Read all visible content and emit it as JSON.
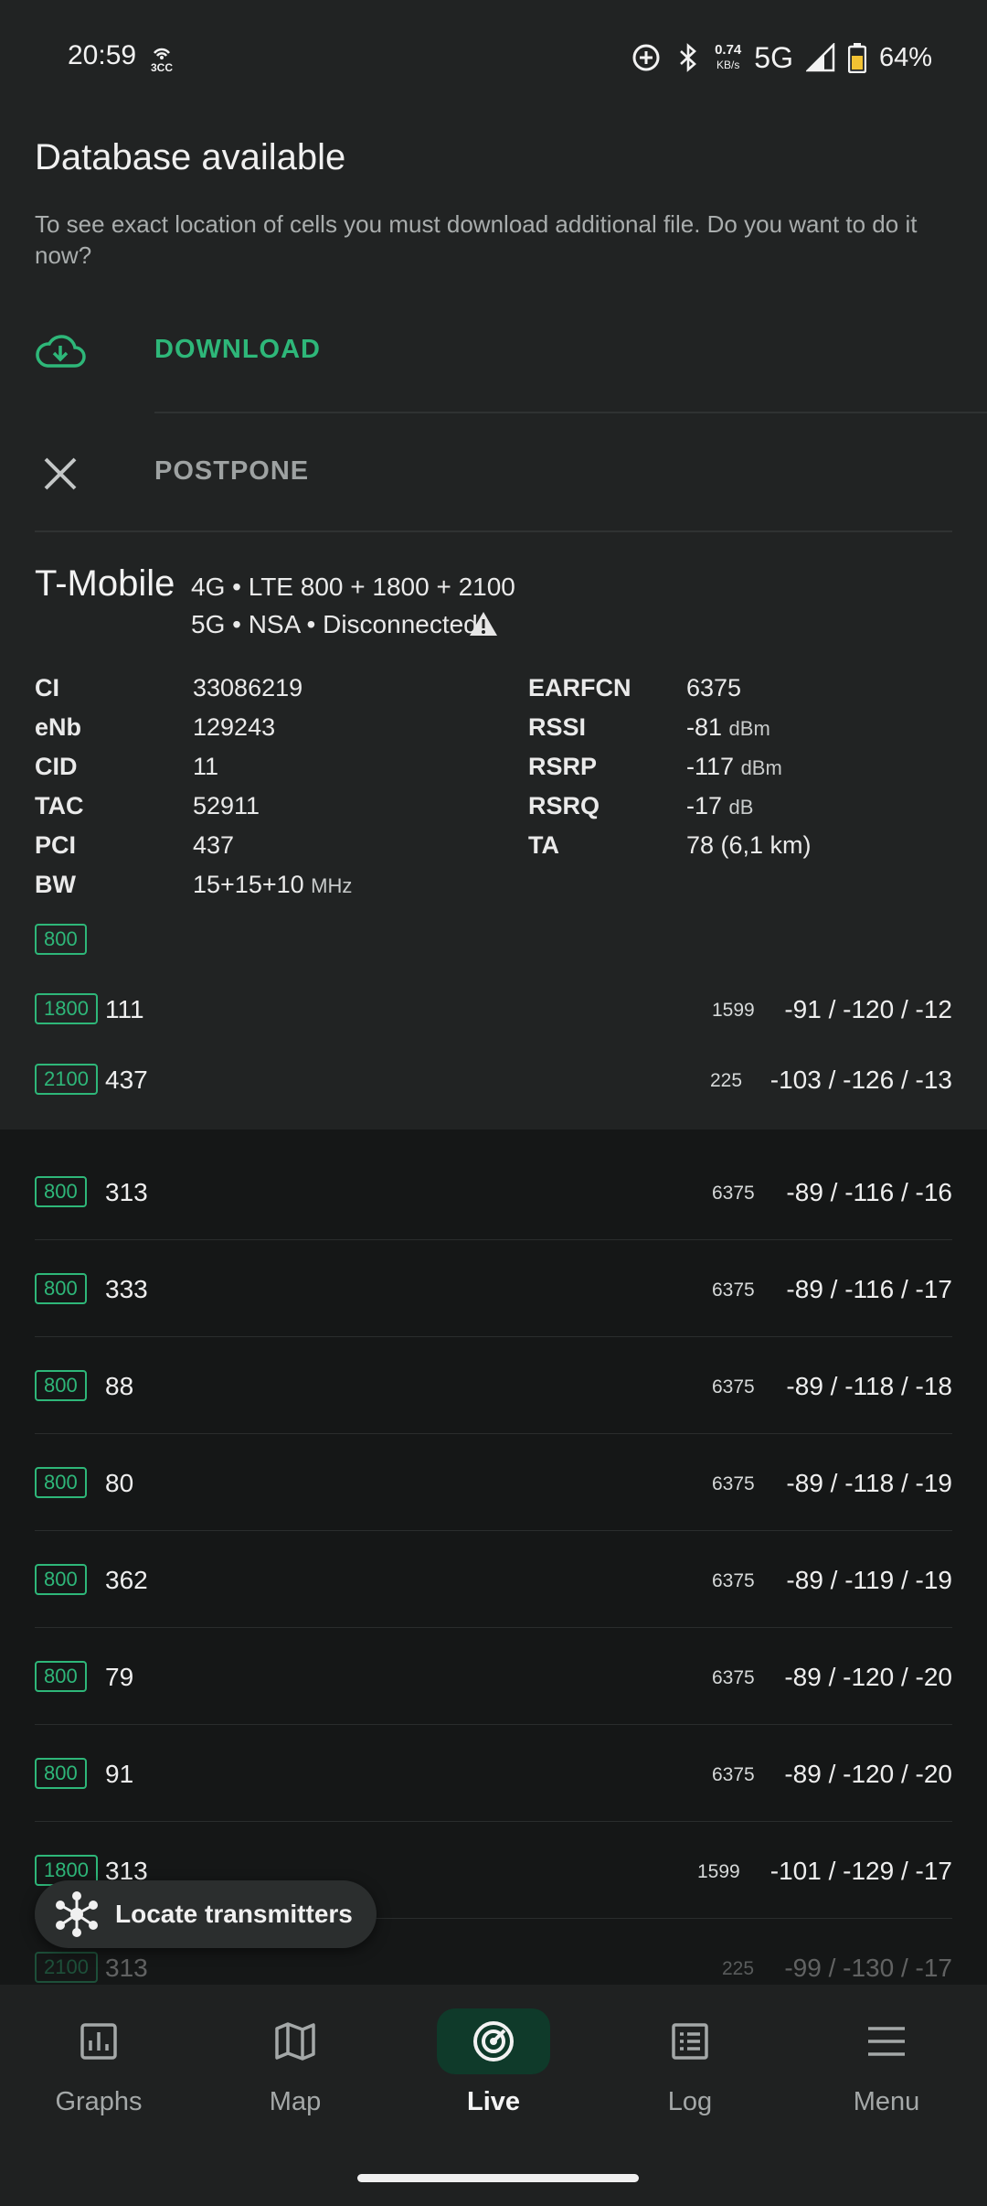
{
  "status_bar": {
    "time": "20:59",
    "carrier_icon_text": "3CC",
    "speed_value": "0.74",
    "speed_unit": "KB/s",
    "network": "5G",
    "battery": "64%"
  },
  "prompt": {
    "title": "Database available",
    "message": "To see exact location of cells you must download additional file. Do you want to do it now?",
    "download_label": "DOWNLOAD",
    "postpone_label": "POSTPONE"
  },
  "operator": {
    "name": "T-Mobile",
    "line1": "4G • LTE 800 + 1800 + 2100",
    "line2": "5G • NSA • Disconnected"
  },
  "cell_info": {
    "left": [
      {
        "key": "CI",
        "value": "33086219",
        "unit": ""
      },
      {
        "key": "eNb",
        "value": "129243",
        "unit": ""
      },
      {
        "key": "CID",
        "value": "11",
        "unit": ""
      },
      {
        "key": "TAC",
        "value": "52911",
        "unit": ""
      },
      {
        "key": "PCI",
        "value": "437",
        "unit": ""
      },
      {
        "key": "BW",
        "value": "15+15+10",
        "unit": "MHz"
      }
    ],
    "right": [
      {
        "key": "EARFCN",
        "value": "6375",
        "unit": ""
      },
      {
        "key": "RSSI",
        "value": "-81",
        "unit": "dBm"
      },
      {
        "key": "RSRP",
        "value": "-117",
        "unit": "dBm"
      },
      {
        "key": "RSRQ",
        "value": "-17",
        "unit": "dB"
      },
      {
        "key": "TA",
        "value": "78 (6,1 km)",
        "unit": ""
      }
    ]
  },
  "primary_band": "800",
  "serving_cells": [
    {
      "band": "1800",
      "pci": "111",
      "earfcn": "1599",
      "signal": "-91 / -120 / -12"
    },
    {
      "band": "2100",
      "pci": "437",
      "earfcn": "225",
      "signal": "-103 / -126 / -13"
    }
  ],
  "neighbors": [
    {
      "band": "800",
      "pci": "313",
      "earfcn": "6375",
      "signal": "-89 / -116 / -16"
    },
    {
      "band": "800",
      "pci": "333",
      "earfcn": "6375",
      "signal": "-89 / -116 / -17"
    },
    {
      "band": "800",
      "pci": "88",
      "earfcn": "6375",
      "signal": "-89 / -118 / -18"
    },
    {
      "band": "800",
      "pci": "80",
      "earfcn": "6375",
      "signal": "-89 / -118 / -19"
    },
    {
      "band": "800",
      "pci": "362",
      "earfcn": "6375",
      "signal": "-89 / -119 / -19"
    },
    {
      "band": "800",
      "pci": "79",
      "earfcn": "6375",
      "signal": "-89 / -120 / -20"
    },
    {
      "band": "800",
      "pci": "91",
      "earfcn": "6375",
      "signal": "-89 / -120 / -20"
    },
    {
      "band": "1800",
      "pci": "313",
      "earfcn": "1599",
      "signal": "-101 / -129 / -17"
    },
    {
      "band": "2100",
      "pci": "313",
      "earfcn": "225",
      "signal": "-99 / -130 / -17"
    }
  ],
  "locate_button": "Locate transmitters",
  "nav": [
    {
      "label": "Graphs",
      "icon": "graphs-icon"
    },
    {
      "label": "Map",
      "icon": "map-icon"
    },
    {
      "label": "Live",
      "icon": "live-icon"
    },
    {
      "label": "Log",
      "icon": "log-icon"
    },
    {
      "label": "Menu",
      "icon": "menu-icon"
    }
  ],
  "colors": {
    "accent": "#2eb779",
    "background": "#151717",
    "card": "#212323"
  }
}
